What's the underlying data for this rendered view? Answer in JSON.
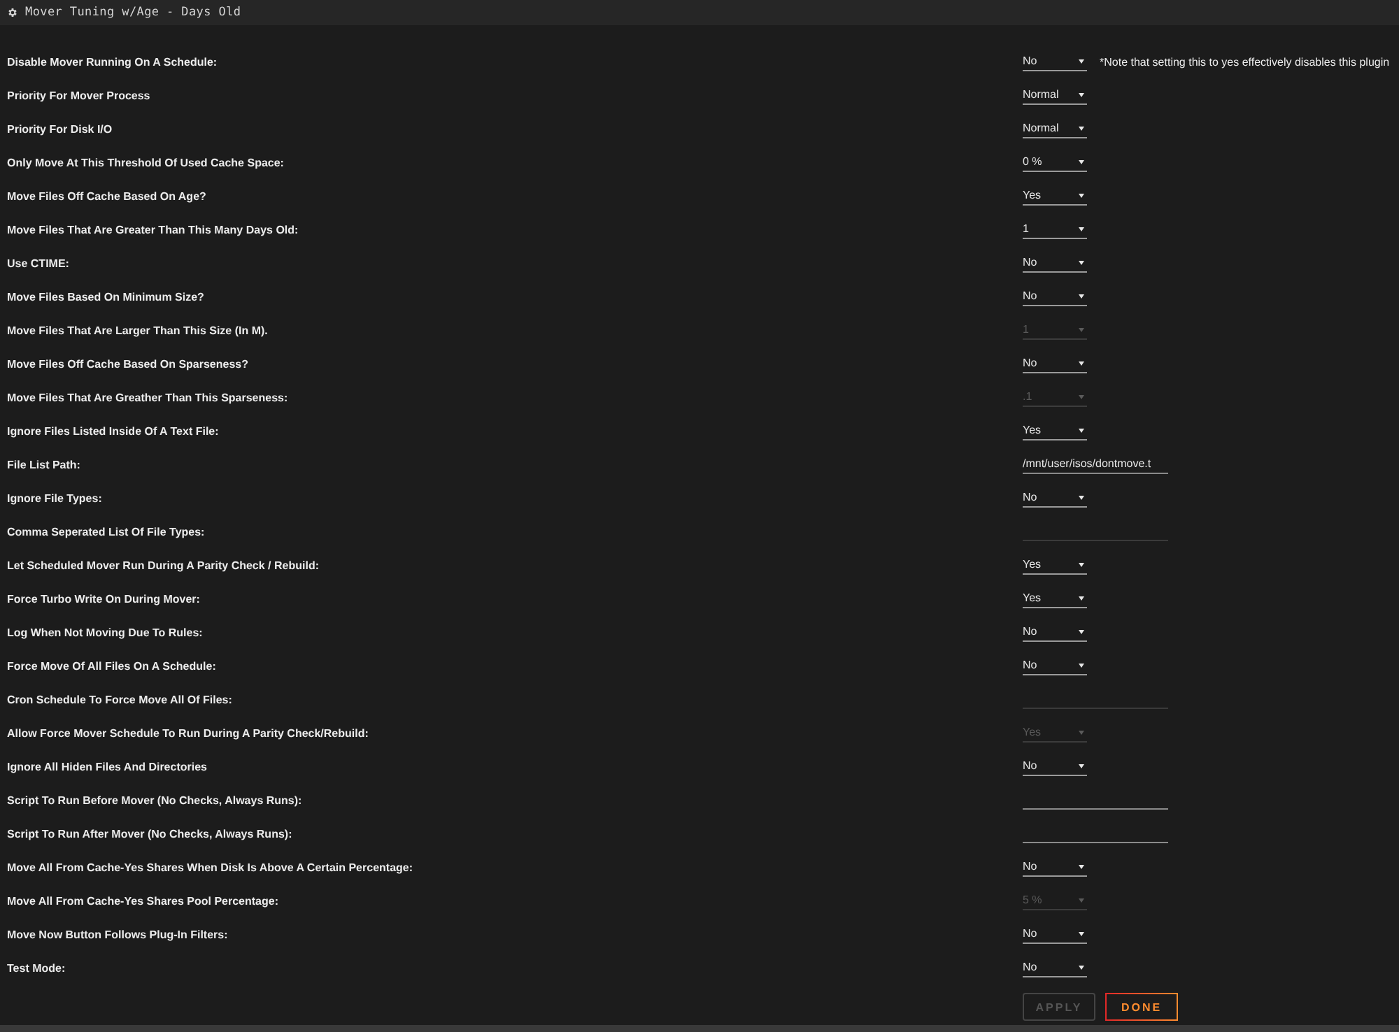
{
  "panel": {
    "title": "Mover Tuning w/Age - Days Old"
  },
  "settings": [
    {
      "label": "Disable Mover Running On A Schedule:",
      "kind": "select",
      "value": "No",
      "disabled": false,
      "note": "*Note that setting this to yes effectively disables this plugin"
    },
    {
      "label": "Priority For Mover Process",
      "kind": "select",
      "value": "Normal",
      "disabled": false
    },
    {
      "label": "Priority For Disk I/O",
      "kind": "select",
      "value": "Normal",
      "disabled": false
    },
    {
      "label": "Only Move At This Threshold Of Used Cache Space:",
      "kind": "select",
      "value": "0 %",
      "disabled": false
    },
    {
      "label": "Move Files Off Cache Based On Age?",
      "kind": "select",
      "value": "Yes",
      "disabled": false
    },
    {
      "label": "Move Files That Are Greater Than This Many Days Old:",
      "kind": "select",
      "value": "1",
      "disabled": false
    },
    {
      "label": "Use CTIME:",
      "kind": "select",
      "value": "No",
      "disabled": false
    },
    {
      "label": "Move Files Based On Minimum Size?",
      "kind": "select",
      "value": "No",
      "disabled": false
    },
    {
      "label": "Move Files That Are Larger Than This Size (In M).",
      "kind": "select",
      "value": "1",
      "disabled": true
    },
    {
      "label": "Move Files Off Cache Based On Sparseness?",
      "kind": "select",
      "value": "No",
      "disabled": false
    },
    {
      "label": "Move Files That Are Greather Than This Sparseness:",
      "kind": "select",
      "value": ".1",
      "disabled": true
    },
    {
      "label": "Ignore Files Listed Inside Of A Text File:",
      "kind": "select",
      "value": "Yes",
      "disabled": false
    },
    {
      "label": "File List Path:",
      "kind": "text",
      "value": "/mnt/user/isos/dontmove.t",
      "disabled": false
    },
    {
      "label": "Ignore File Types:",
      "kind": "select",
      "value": "No",
      "disabled": false
    },
    {
      "label": "Comma Seperated List Of File Types:",
      "kind": "text",
      "disabled": true
    },
    {
      "label": "Let Scheduled Mover Run During A Parity Check / Rebuild:",
      "kind": "select",
      "value": "Yes",
      "disabled": false
    },
    {
      "label": "Force Turbo Write On During Mover:",
      "kind": "select",
      "value": "Yes",
      "disabled": false
    },
    {
      "label": "Log When Not Moving Due To Rules:",
      "kind": "select",
      "value": "No",
      "disabled": false
    },
    {
      "label": "Force Move Of All Files On A Schedule:",
      "kind": "select",
      "value": "No",
      "disabled": false
    },
    {
      "label": "Cron Schedule To Force Move All Of Files:",
      "kind": "text",
      "disabled": true
    },
    {
      "label": "Allow Force Mover Schedule To Run During A Parity Check/Rebuild:",
      "kind": "select",
      "value": "Yes",
      "disabled": true
    },
    {
      "label": "Ignore All Hiden Files And Directories",
      "kind": "select",
      "value": "No",
      "disabled": false
    },
    {
      "label": "Script To Run Before Mover (No Checks, Always Runs):",
      "kind": "text",
      "disabled": false
    },
    {
      "label": "Script To Run After Mover (No Checks, Always Runs):",
      "kind": "text",
      "disabled": false
    },
    {
      "label": "Move All From Cache-Yes Shares When Disk Is Above A Certain Percentage:",
      "kind": "select",
      "value": "No",
      "disabled": false
    },
    {
      "label": "Move All From Cache-Yes Shares Pool Percentage:",
      "kind": "select",
      "value": "5 %",
      "disabled": true
    },
    {
      "label": "Move Now Button Follows Plug-In Filters:",
      "kind": "select",
      "value": "No",
      "disabled": false
    },
    {
      "label": "Test Mode:",
      "kind": "select",
      "value": "No",
      "disabled": false
    }
  ],
  "buttons": [
    {
      "label": "APPLY",
      "disabled": true
    },
    {
      "label": "DONE",
      "disabled": false
    }
  ]
}
